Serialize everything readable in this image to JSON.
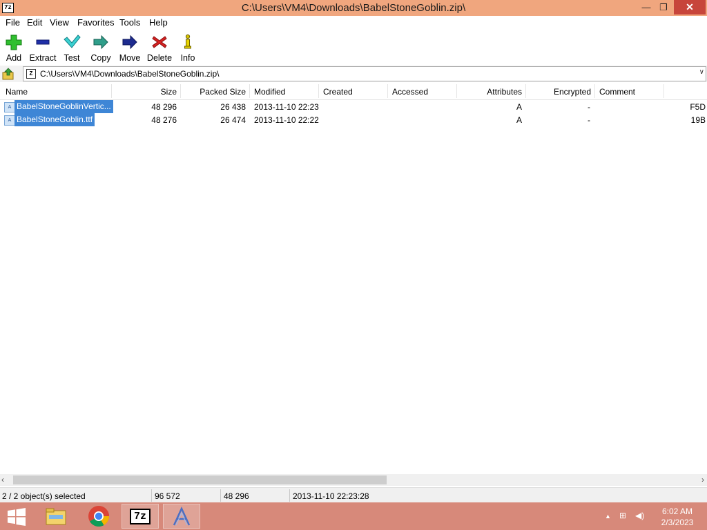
{
  "window": {
    "app_icon_text": "7z",
    "title": "C:\\Users\\VM4\\Downloads\\BabelStoneGoblin.zip\\",
    "min_glyph": "—",
    "max_glyph": "❐",
    "close_glyph": "✕"
  },
  "menu": [
    "File",
    "Edit",
    "View",
    "Favorites",
    "Tools",
    "Help"
  ],
  "toolbar": {
    "add": "Add",
    "extract": "Extract",
    "test": "Test",
    "copy": "Copy",
    "move": "Move",
    "delete": "Delete",
    "info": "Info"
  },
  "address": {
    "path": "C:\\Users\\VM4\\Downloads\\BabelStoneGoblin.zip\\",
    "zip_glyph": "Z",
    "dropdown_glyph": "∨"
  },
  "columns": {
    "name": "Name",
    "size": "Size",
    "packed": "Packed Size",
    "modified": "Modified",
    "created": "Created",
    "accessed": "Accessed",
    "attributes": "Attributes",
    "encrypted": "Encrypted",
    "comment": "Comment"
  },
  "files": [
    {
      "name": "BabelStoneGoblinVertic...",
      "size": "48 296",
      "packed": "26 438",
      "modified": "2013-11-10 22:23",
      "attributes": "A",
      "encrypted": "-",
      "crc": "F5D",
      "icon_glyph": "A"
    },
    {
      "name": "BabelStoneGoblin.ttf",
      "size": "48 276",
      "packed": "26 474",
      "modified": "2013-11-10 22:22",
      "attributes": "A",
      "encrypted": "-",
      "crc": "19B",
      "icon_glyph": "A"
    }
  ],
  "scroll": {
    "left_glyph": "‹",
    "right_glyph": "›"
  },
  "status": {
    "selected": "2 / 2 object(s) selected",
    "total_size": "96 572",
    "selected_size": "48 296",
    "modified": "2013-11-10 22:23:28"
  },
  "taskbar": {
    "sevenzip_text": "7z",
    "tray_arrow": "▲",
    "network_glyph": "⊞",
    "volume_glyph": "◀)",
    "time": "6:02 AM",
    "date": "2/3/2023"
  }
}
